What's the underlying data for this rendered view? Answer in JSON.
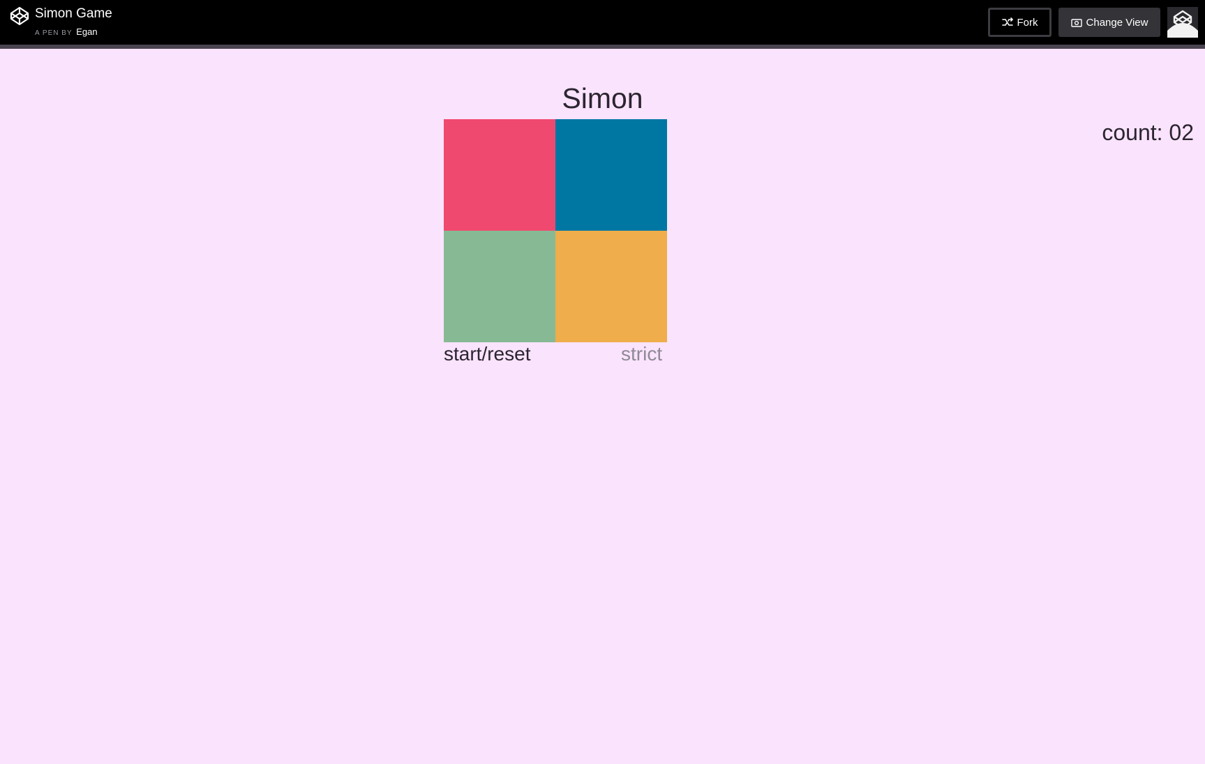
{
  "header": {
    "title": "Simon Game",
    "byline_prefix": "A PEN BY",
    "author": "Egan",
    "fork_label": "Fork",
    "change_view_label": "Change View"
  },
  "game": {
    "title": "Simon",
    "count_label": "count: 02",
    "start_label": "start/reset",
    "strict_label": "strict",
    "pads": {
      "red": "#f0496f",
      "blue": "#0077a3",
      "green": "#87ba94",
      "yellow": "#efad4b"
    }
  }
}
